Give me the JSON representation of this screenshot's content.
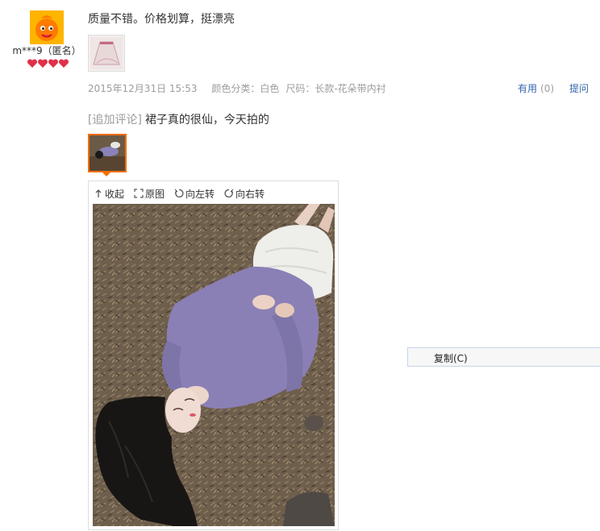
{
  "review": {
    "user": {
      "name": "m***9（匿名）"
    },
    "text": "质量不错。价格划算，挺漂亮",
    "date": "2015年12月31日 15:53",
    "sku_color": "颜色分类：白色",
    "sku_size": "尺码：长款-花朵带内衬",
    "useful_label": "有用",
    "useful_count": "(0)",
    "ask_label": "提问",
    "append_tag": "[追加评论]",
    "append_text": "裙子真的很仙，今天拍的"
  },
  "viewer": {
    "toolbar": {
      "collapse": "收起",
      "original": "原图",
      "rotate_left": "向左转",
      "rotate_right": "向右转"
    }
  },
  "context_menu": {
    "copy": "复制(C)"
  },
  "icons": {
    "avatar": "orange-mascot-avatar",
    "rank": "red-heart-rank-icons",
    "collapse": "up-arrow-icon",
    "original": "expand-icon",
    "rotate_left": "rotate-left-icon",
    "rotate_right": "rotate-right-icon"
  },
  "colors": {
    "link": "#3366aa",
    "muted": "#9c9c9c",
    "accent_orange": "#f46f00",
    "heart_red": "#e0304a"
  }
}
